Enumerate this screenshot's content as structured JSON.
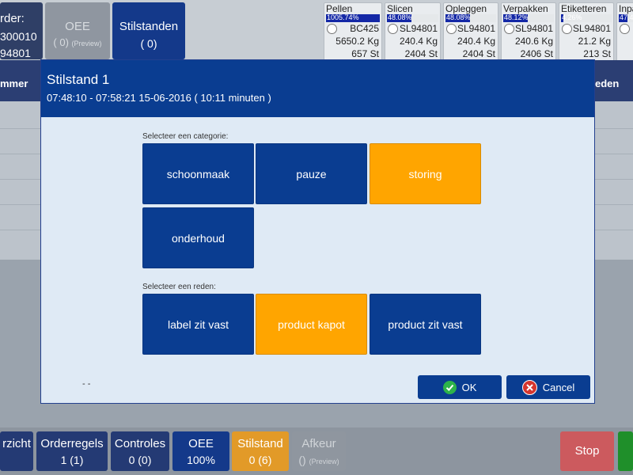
{
  "header": {
    "order_label": "rder:",
    "order_line1": "300010",
    "order_line2": "94801",
    "oee_title": "OEE",
    "oee_value": "( 0)",
    "oee_preview": "(Preview)",
    "stilstanden_title": "Stilstanden",
    "stilstanden_value": "( 0)"
  },
  "stations": [
    {
      "name": "Pellen",
      "percent": "1005.74%",
      "fill": 1.0,
      "code": "BC425",
      "weight": "5650.2 Kg",
      "count": "657 St"
    },
    {
      "name": "Slicen",
      "percent": "48.08%",
      "fill": 0.4808,
      "code": "SL94801",
      "weight": "240.4 Kg",
      "count": "2404 St"
    },
    {
      "name": "Opleggen",
      "percent": "48.08%",
      "fill": 0.4808,
      "code": "SL94801",
      "weight": "240.4 Kg",
      "count": "2404 St"
    },
    {
      "name": "Verpakken",
      "percent": "48.12%",
      "fill": 0.4812,
      "code": "SL94801",
      "weight": "240.6 Kg",
      "count": "2406 St"
    },
    {
      "name": "Etiketteren",
      "percent": "4.26%",
      "fill": 0.0426,
      "code": "SL94801",
      "weight": "21.2 Kg",
      "count": "213 St"
    },
    {
      "name": "Inpa",
      "percent": "47.4",
      "fill": 0.474,
      "code": "",
      "weight": "",
      "count": ""
    }
  ],
  "table_header": {
    "left": "mmer",
    "right": "eden"
  },
  "modal": {
    "title": "Stilstand 1",
    "subtitle": "07:48:10 - 07:58:21 15-06-2016 ( 10:11 minuten )",
    "category_label": "Selecteer een categorie:",
    "categories": [
      {
        "label": "schoonmaak",
        "selected": false
      },
      {
        "label": "pauze",
        "selected": false
      },
      {
        "label": "storing",
        "selected": true
      },
      {
        "label": "onderhoud",
        "selected": false
      }
    ],
    "reason_label": "Selecteer een reden:",
    "reasons": [
      {
        "label": "label zit vast",
        "selected": false
      },
      {
        "label": "product kapot",
        "selected": true
      },
      {
        "label": "product zit vast",
        "selected": false
      }
    ],
    "dashes": "- -",
    "ok_label": "OK",
    "cancel_label": "Cancel"
  },
  "bottom_tabs": [
    {
      "label": "rzicht",
      "value": ""
    },
    {
      "label": "Orderregels",
      "value": "1 (1)"
    },
    {
      "label": "Controles",
      "value": "0 (0)"
    },
    {
      "label": "OEE",
      "value": "100%"
    },
    {
      "label": "Stilstand",
      "value": "0 (6)"
    },
    {
      "label": "Afkeur",
      "value": "()",
      "preview": "(Preview)"
    },
    {
      "label": "Stop",
      "value": ""
    }
  ],
  "colors": {
    "primary": "#0a3d91",
    "selected": "#ffa500",
    "stop": "#cc5a5e",
    "ok_icon": "#2db34a",
    "cancel_icon": "#d6362f"
  }
}
